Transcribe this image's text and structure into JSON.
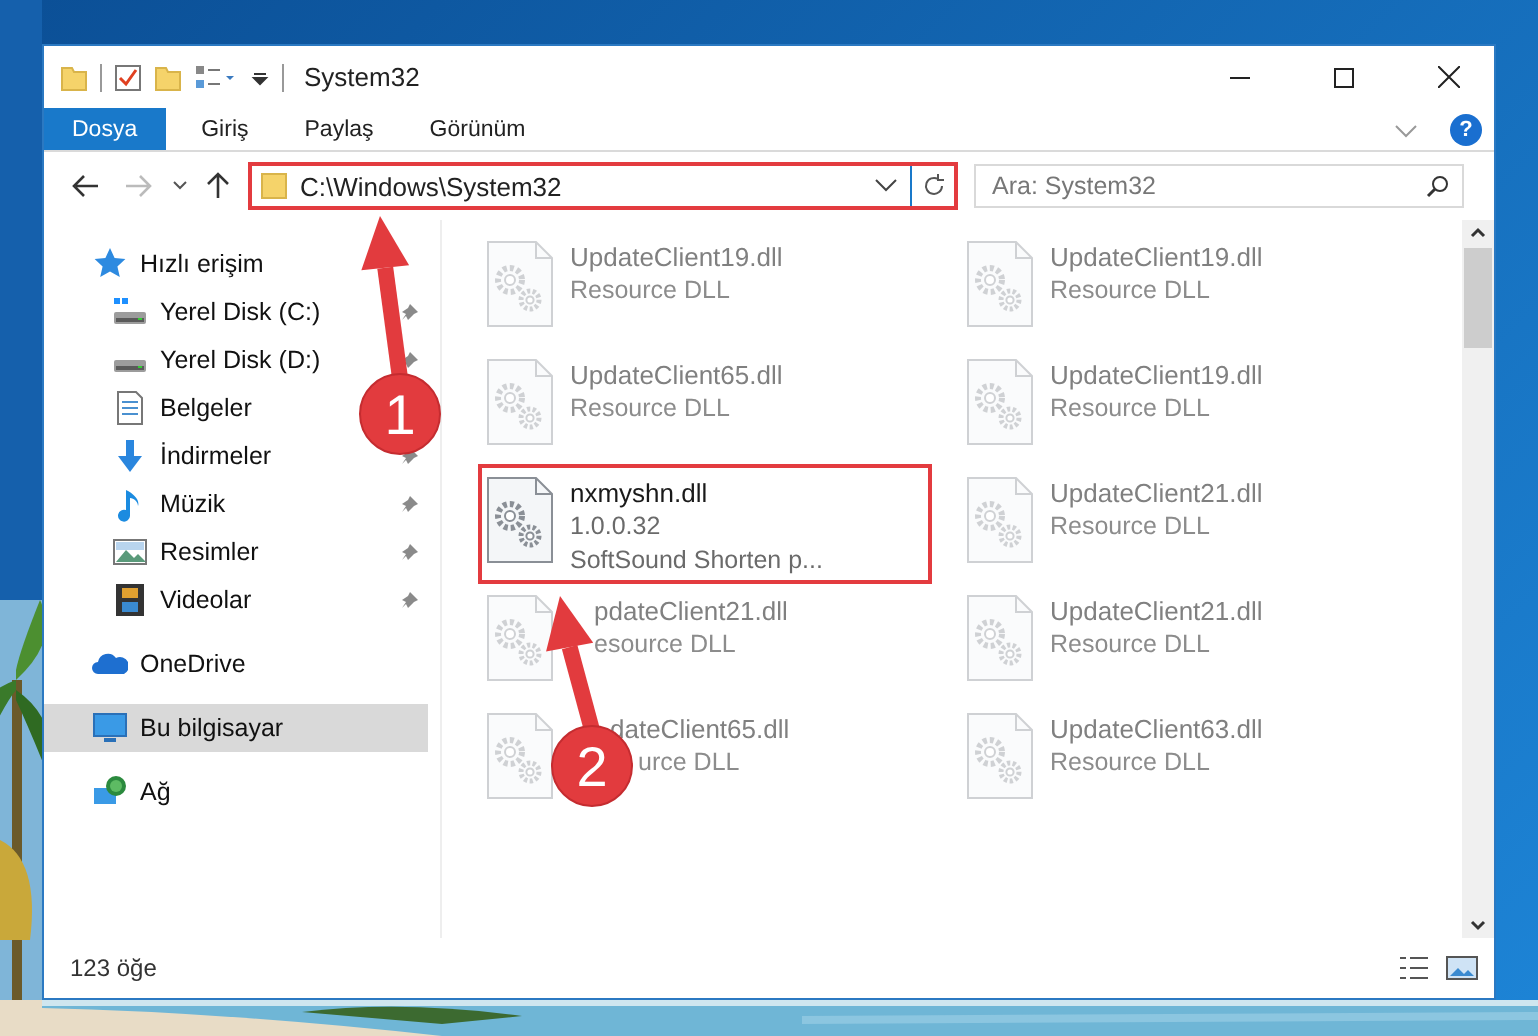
{
  "window": {
    "title": "System32"
  },
  "ribbon": {
    "tabs": [
      {
        "label": "Dosya",
        "kind": "file"
      },
      {
        "label": "Giriş",
        "kind": "tab"
      },
      {
        "label": "Paylaş",
        "kind": "tab"
      },
      {
        "label": "Görünüm",
        "kind": "tab"
      }
    ],
    "help": "?"
  },
  "address_bar": {
    "path": "C:\\Windows\\System32",
    "highlighted": true
  },
  "search": {
    "placeholder": "Ara: System32"
  },
  "sidebar": {
    "items": [
      {
        "label": "Hızlı erişim",
        "kind": "star",
        "selected": false,
        "children": [
          {
            "label": "Yerel Disk (C:)",
            "kind": "drive-system",
            "pinned": true
          },
          {
            "label": "Yerel Disk (D:)",
            "kind": "drive",
            "pinned": true
          },
          {
            "label": "Belgeler",
            "kind": "document"
          },
          {
            "label": "İndirmeler",
            "kind": "download",
            "pinned": true
          },
          {
            "label": "Müzik",
            "kind": "music",
            "pinned": true
          },
          {
            "label": "Resimler",
            "kind": "pictures",
            "pinned": true
          },
          {
            "label": "Videolar",
            "kind": "video",
            "pinned": true
          }
        ]
      },
      {
        "label": "OneDrive",
        "kind": "cloud",
        "selected": false
      },
      {
        "label": "Bu bilgisayar",
        "kind": "computer",
        "selected": true
      },
      {
        "label": "Ağ",
        "kind": "network",
        "selected": false
      }
    ]
  },
  "files": [
    {
      "name": "UpdateClient19.dll",
      "lines": [
        "Resource DLL"
      ],
      "dimmed": true,
      "highlighted": false
    },
    {
      "name": "UpdateClient19.dll",
      "lines": [
        "Resource DLL"
      ],
      "dimmed": true,
      "highlighted": false
    },
    {
      "name": "UpdateClient65.dll",
      "lines": [
        "Resource DLL"
      ],
      "dimmed": true,
      "highlighted": false
    },
    {
      "name": "UpdateClient19.dll",
      "lines": [
        "Resource DLL"
      ],
      "dimmed": true,
      "highlighted": false
    },
    {
      "name": "nxmyshn.dll",
      "lines": [
        "1.0.0.32",
        "SoftSound Shorten p..."
      ],
      "dimmed": false,
      "highlighted": true
    },
    {
      "name": "UpdateClient21.dll",
      "lines": [
        "Resource DLL"
      ],
      "dimmed": true,
      "highlighted": false
    },
    {
      "name": "pdateClient21.dll",
      "lines": [
        "esource DLL"
      ],
      "dimmed": true,
      "highlighted": false,
      "kind": "under-arrow"
    },
    {
      "name": "UpdateClient21.dll",
      "lines": [
        "Resource DLL"
      ],
      "dimmed": true,
      "highlighted": false
    },
    {
      "name": "dateClient65.dll",
      "lines": [
        "urce DLL"
      ],
      "dimmed": true,
      "highlighted": false,
      "kind": "under-badge"
    },
    {
      "name": "UpdateClient63.dll",
      "lines": [
        "Resource DLL"
      ],
      "dimmed": true,
      "highlighted": false
    }
  ],
  "status_bar": {
    "count": "123 öğe"
  },
  "annotations": [
    {
      "number": "1"
    },
    {
      "number": "2"
    }
  ]
}
